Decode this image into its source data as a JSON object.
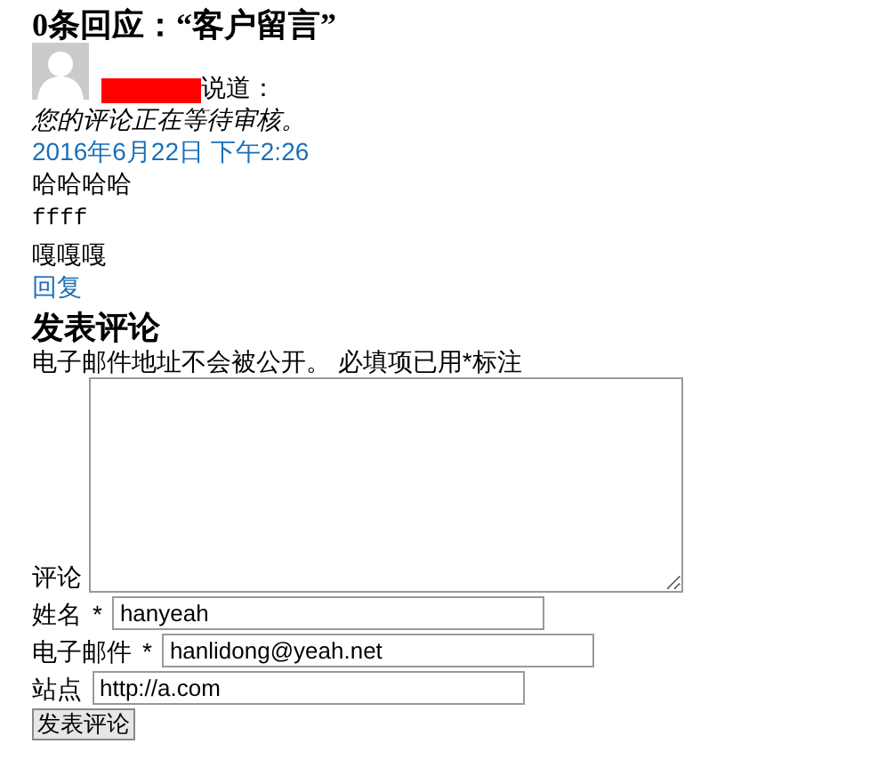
{
  "comments_title": "0条回应：“客户留言”",
  "comment": {
    "said": "说道：",
    "moderation_note": "您的评论正在等待审核。",
    "date": "2016年6月22日 下午2:26",
    "lines": [
      {
        "kind": "text",
        "text": "哈哈哈哈"
      },
      {
        "kind": "code",
        "text": "ffff"
      },
      {
        "kind": "text",
        "text": "嘎嘎嘎"
      }
    ],
    "reply": "回复"
  },
  "form": {
    "title": "发表评论",
    "notes": "电子邮件地址不会被公开。 必填项已用*标注",
    "comment_label": "评论",
    "fields": [
      {
        "label": "姓名",
        "required_mark": "*",
        "value": "hanyeah"
      },
      {
        "label": "电子邮件",
        "required_mark": "*",
        "value": "hanlidong@yeah.net"
      },
      {
        "label": "站点",
        "value": "http://a.com"
      }
    ],
    "submit": "发表评论"
  }
}
